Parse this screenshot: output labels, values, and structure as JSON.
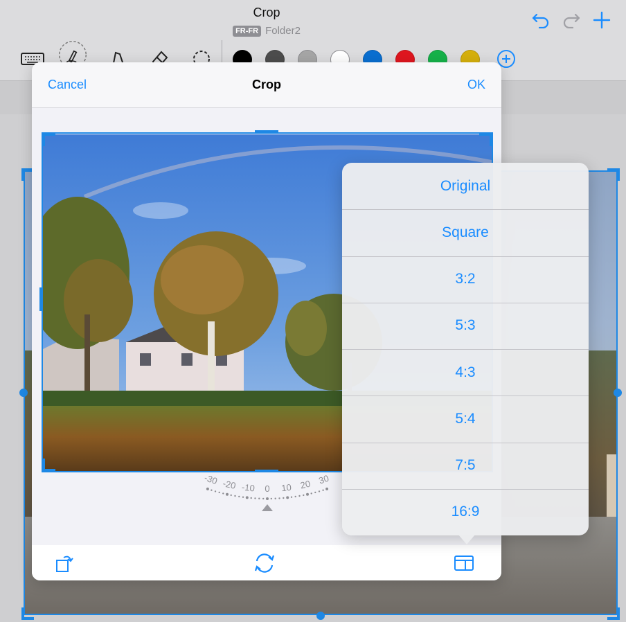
{
  "document": {
    "title": "Crop",
    "language_badge": "FR-FR",
    "folder": "Folder2"
  },
  "top_actions": [
    "undo-icon",
    "redo-icon",
    "add-icon"
  ],
  "tools": [
    "keyboard-icon",
    "lasso-pen-icon",
    "highlighter-icon",
    "eraser-icon",
    "lasso-select-icon"
  ],
  "palette": [
    "#000000",
    "#4d4d4d",
    "#a6a6a6",
    "#ffffff",
    "#0a6fd1",
    "#e0161f",
    "#16b24a",
    "#d6b00c"
  ],
  "dialog": {
    "cancel_label": "Cancel",
    "title": "Crop",
    "ok_label": "OK",
    "rotation_ticks": [
      "-30",
      "-20",
      "-10",
      "0",
      "10",
      "20",
      "30"
    ]
  },
  "aspect_menu": {
    "options": [
      "Original",
      "Square",
      "3:2",
      "5:3",
      "4:3",
      "5:4",
      "7:5",
      "16:9"
    ]
  },
  "footer": [
    "rotate-icon",
    "flip-icon",
    "aspect-ratio-icon"
  ],
  "colors": {
    "accent": "#1a8cff",
    "selection": "#1e88e5"
  }
}
